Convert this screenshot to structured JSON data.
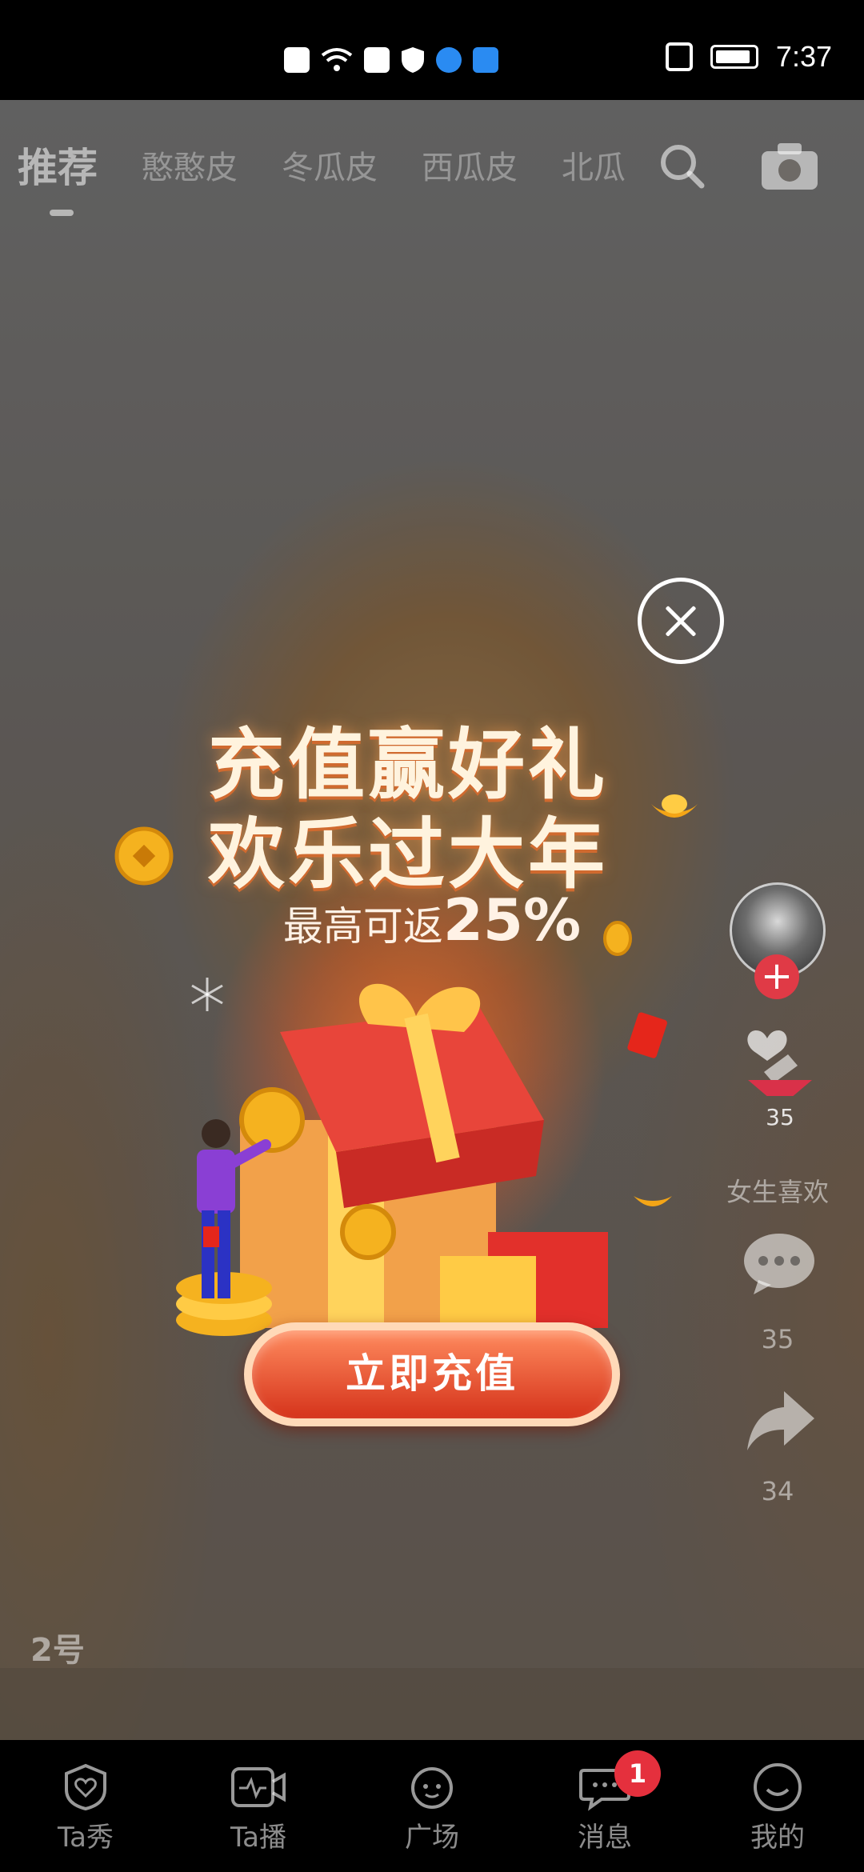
{
  "status_bar": {
    "time": "7:37",
    "icons": [
      "alert-icon",
      "wifi-icon",
      "huawei-icon",
      "shield-icon",
      "browser-icon",
      "cloud-icon",
      "vibrate-icon",
      "battery-icon"
    ]
  },
  "top_tabs": {
    "items": [
      {
        "label": "推荐",
        "active": true
      },
      {
        "label": "憨憨皮",
        "active": false
      },
      {
        "label": "冬瓜皮",
        "active": false
      },
      {
        "label": "西瓜皮",
        "active": false
      },
      {
        "label": "北瓜",
        "active": false
      }
    ]
  },
  "popup": {
    "headline_line1": "充值赢好礼",
    "headline_line2": "欢乐过大年",
    "sub_prefix": "最高可返",
    "sub_percent": "25%",
    "cta_label": "立即充值"
  },
  "right_rail": {
    "like_count": "35",
    "like_caption": "女生喜欢",
    "comment_count": "35",
    "share_count": "34"
  },
  "video": {
    "number_label": "2号"
  },
  "bottom_nav": {
    "items": [
      {
        "label": "Ta秀",
        "icon": "heart-badge-icon"
      },
      {
        "label": "Ta播",
        "icon": "live-camera-icon"
      },
      {
        "label": "广场",
        "icon": "planet-icon"
      },
      {
        "label": "消息",
        "icon": "chat-icon"
      },
      {
        "label": "我的",
        "icon": "smile-icon"
      }
    ],
    "message_badge": "1"
  },
  "colors": {
    "accent_red": "#e5303d",
    "cta_gradient_top": "#ff8b5e",
    "cta_gradient_bottom": "#d5331b"
  }
}
